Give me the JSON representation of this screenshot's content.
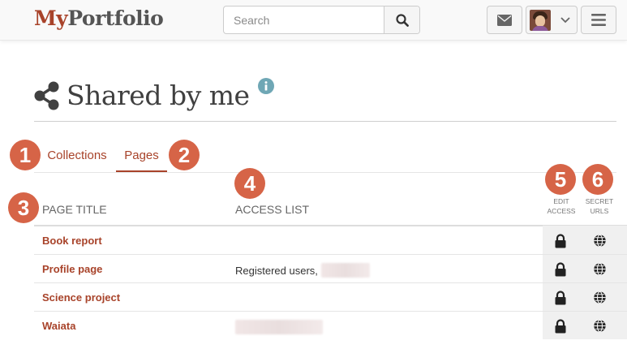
{
  "header": {
    "logo_my": "My",
    "logo_rest": "Portfolio",
    "search_placeholder": "Search"
  },
  "page": {
    "title": "Shared by me"
  },
  "tabs": [
    {
      "label": "Collections",
      "active": false
    },
    {
      "label": "Pages",
      "active": true
    }
  ],
  "table": {
    "columns": {
      "page_title": "Page title",
      "access_list": "Access list",
      "edit_access_1": "Edit",
      "edit_access_2": "access",
      "secret_urls_1": "Secret",
      "secret_urls_2": "URLs"
    },
    "rows": [
      {
        "title": "Book report",
        "access": ""
      },
      {
        "title": "Profile page",
        "access": "Registered users,"
      },
      {
        "title": "Science project",
        "access": ""
      },
      {
        "title": "Waiata",
        "access": ""
      }
    ]
  },
  "callouts": [
    "1",
    "2",
    "3",
    "4",
    "5",
    "6"
  ],
  "colors": {
    "brand": "#a8432a",
    "callout": "#d66447",
    "info": "#6fa7b5"
  },
  "icons": [
    "envelope-icon",
    "chevron-down-icon",
    "hamburger-icon",
    "search-icon",
    "share-icon",
    "info-icon",
    "lock-icon",
    "globe-icon"
  ]
}
